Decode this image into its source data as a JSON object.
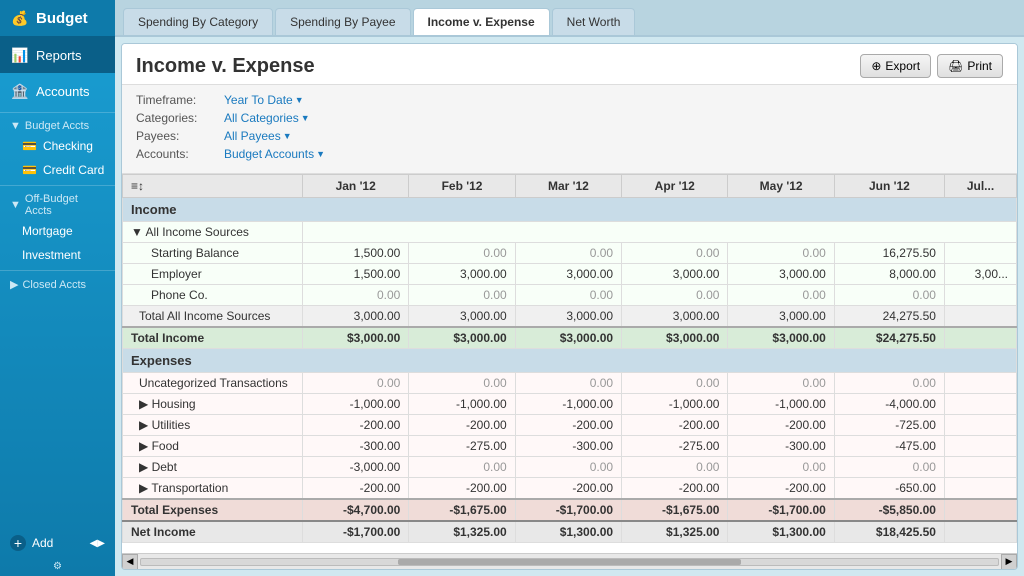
{
  "sidebar": {
    "app_name": "Budget",
    "items": [
      {
        "id": "reports",
        "label": "Reports",
        "icon": "📊",
        "active": true
      },
      {
        "id": "accounts",
        "label": "Accounts",
        "icon": "🏦",
        "active": false
      }
    ],
    "budget_accts_label": "Budget Accts",
    "budget_accts_items": [
      {
        "id": "checking",
        "label": "Checking",
        "icon": "💳"
      },
      {
        "id": "credit-card",
        "label": "Credit Card",
        "icon": "💳"
      }
    ],
    "off_budget_label": "Off-Budget Accts",
    "off_budget_items": [
      {
        "id": "mortgage",
        "label": "Mortgage"
      },
      {
        "id": "investment",
        "label": "Investment"
      }
    ],
    "closed_accts_label": "Closed Accts",
    "add_label": "Add"
  },
  "tabs": [
    {
      "id": "spending-by-category",
      "label": "Spending By Category"
    },
    {
      "id": "spending-by-payee",
      "label": "Spending By Payee"
    },
    {
      "id": "income-v-expense",
      "label": "Income v. Expense",
      "active": true
    },
    {
      "id": "net-worth",
      "label": "Net Worth"
    }
  ],
  "report": {
    "title": "Income v. Expense",
    "export_label": "Export",
    "print_label": "Print",
    "filters": {
      "timeframe_label": "Timeframe:",
      "timeframe_value": "Year To Date",
      "categories_label": "Categories:",
      "categories_value": "All Categories",
      "payees_label": "Payees:",
      "payees_value": "All Payees",
      "accounts_label": "Accounts:",
      "accounts_value": "Budget Accounts"
    },
    "sort_icons": "≡↕",
    "columns": [
      "",
      "Jan '12",
      "Feb '12",
      "Mar '12",
      "Apr '12",
      "May '12",
      "Jun '12",
      "Ju..."
    ],
    "income_section": "Income",
    "all_income_sources": "▼ All Income Sources",
    "rows": {
      "starting_balance": {
        "label": "Starting Balance",
        "jan": "1,500.00",
        "feb": "0.00",
        "mar": "0.00",
        "apr": "0.00",
        "may": "0.00",
        "jun": "16,275.50"
      },
      "employer": {
        "label": "Employer",
        "jan": "1,500.00",
        "feb": "3,000.00",
        "mar": "3,000.00",
        "apr": "3,000.00",
        "may": "3,000.00",
        "jun": "8,000.00",
        "extra": "3,00..."
      },
      "phone_co": {
        "label": "Phone Co.",
        "jan": "0.00",
        "feb": "0.00",
        "mar": "0.00",
        "apr": "0.00",
        "may": "0.00",
        "jun": "0.00"
      },
      "total_all_income": {
        "label": "Total All Income Sources",
        "jan": "3,000.00",
        "feb": "3,000.00",
        "mar": "3,000.00",
        "apr": "3,000.00",
        "may": "3,000.00",
        "jun": "24,275.50"
      },
      "total_income": {
        "label": "Total Income",
        "jan": "$3,000.00",
        "feb": "$3,000.00",
        "mar": "$3,000.00",
        "apr": "$3,000.00",
        "may": "$3,000.00",
        "jun": "$24,275.50"
      },
      "expenses_section": "Expenses",
      "uncategorized": {
        "label": "Uncategorized Transactions",
        "jan": "0.00",
        "feb": "0.00",
        "mar": "0.00",
        "apr": "0.00",
        "may": "0.00",
        "jun": "0.00"
      },
      "housing": {
        "label": "▶ Housing",
        "jan": "-1,000.00",
        "feb": "-1,000.00",
        "mar": "-1,000.00",
        "apr": "-1,000.00",
        "may": "-1,000.00",
        "jun": "-4,000.00"
      },
      "utilities": {
        "label": "▶ Utilities",
        "jan": "-200.00",
        "feb": "-200.00",
        "mar": "-200.00",
        "apr": "-200.00",
        "may": "-200.00",
        "jun": "-725.00"
      },
      "food": {
        "label": "▶ Food",
        "jan": "-300.00",
        "feb": "-275.00",
        "mar": "-300.00",
        "apr": "-275.00",
        "may": "-300.00",
        "jun": "-475.00"
      },
      "debt": {
        "label": "▶ Debt",
        "jan": "-3,000.00",
        "feb": "0.00",
        "mar": "0.00",
        "apr": "0.00",
        "may": "0.00",
        "jun": "0.00"
      },
      "transportation": {
        "label": "▶ Transportation",
        "jan": "-200.00",
        "feb": "-200.00",
        "mar": "-200.00",
        "apr": "-200.00",
        "may": "-200.00",
        "jun": "-650.00"
      },
      "total_expenses": {
        "label": "Total Expenses",
        "jan": "-$4,700.00",
        "feb": "-$1,675.00",
        "mar": "-$1,700.00",
        "apr": "-$1,675.00",
        "may": "-$1,700.00",
        "jun": "-$5,850.00"
      },
      "net_income": {
        "label": "Net Income",
        "jan": "-$1,700.00",
        "feb": "$1,325.00",
        "mar": "$1,300.00",
        "apr": "$1,325.00",
        "may": "$1,300.00",
        "jun": "$18,425.50"
      }
    }
  }
}
